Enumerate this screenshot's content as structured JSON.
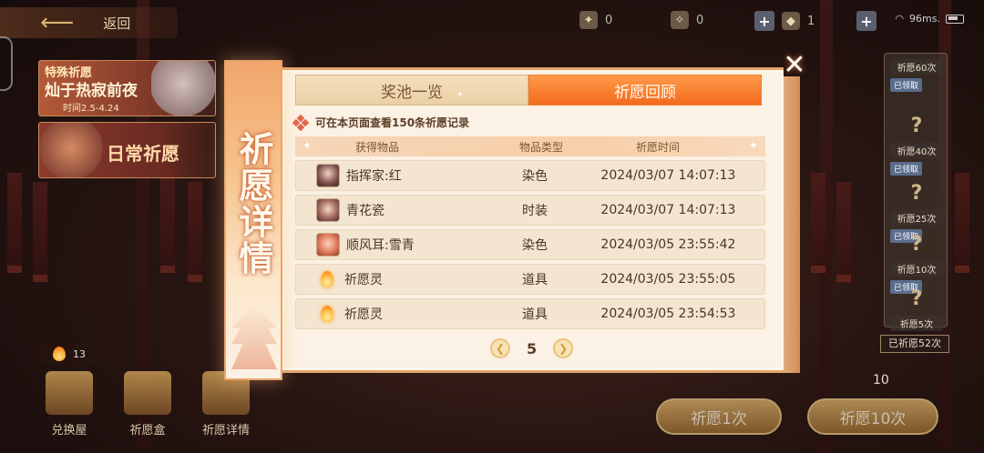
{
  "header": {
    "back_label": "返回",
    "resources": [
      {
        "icon": "wish-wand-icon",
        "value": "0"
      },
      {
        "icon": "gold-wand-icon",
        "value": "0"
      },
      {
        "icon": "crystal-icon",
        "value": "1"
      }
    ],
    "latency": "96ms."
  },
  "events": {
    "special": {
      "tag": "特殊祈愿",
      "title": "灿于热寂前夜",
      "date": "时间2.5-4.24"
    },
    "daily": {
      "title": "日常祈愿"
    }
  },
  "bottom_left": {
    "currency_value": "13",
    "buttons": [
      {
        "label": "兑换屋"
      },
      {
        "label": "祈愿盒"
      },
      {
        "label": "祈愿详情"
      }
    ]
  },
  "right_panel": {
    "rewards": [
      {
        "label": "祈愿60次",
        "badge": "已领取"
      },
      {
        "label": "祈愿40次",
        "badge": "已领取"
      },
      {
        "label": "祈愿25次",
        "badge": "已领取"
      },
      {
        "label": "祈愿10次",
        "badge": "已领取"
      },
      {
        "label": "祈愿5次",
        "badge": ""
      }
    ],
    "wished_count": "已祈愿52次",
    "pity_number": "10",
    "wish_once": "祈愿1次",
    "wish_ten": "祈愿10次"
  },
  "modal": {
    "side_title": "祈愿详情",
    "tabs": [
      {
        "label": "奖池一览",
        "active": false
      },
      {
        "label": "祈愿回顾",
        "active": true
      }
    ],
    "notice": "可在本页面查看150条祈愿记录",
    "columns": {
      "item": "获得物品",
      "type": "物品类型",
      "time": "祈愿时间"
    },
    "rows": [
      {
        "item": "指挥家:红",
        "type": "染色",
        "time": "2024/03/07 14:07:13",
        "icon": "avatar-red-icon"
      },
      {
        "item": "青花瓷",
        "type": "时装",
        "time": "2024/03/07 14:07:13",
        "icon": "avatar-qinghua-icon"
      },
      {
        "item": "顺风耳:雪青",
        "type": "染色",
        "time": "2024/03/05 23:55:42",
        "icon": "avatar-shunfeng-icon"
      },
      {
        "item": "祈愿灵",
        "type": "道具",
        "time": "2024/03/05 23:55:05",
        "icon": "wish-spirit-flame-icon"
      },
      {
        "item": "祈愿灵",
        "type": "道具",
        "time": "2024/03/05 23:54:53",
        "icon": "wish-spirit-flame-icon"
      }
    ],
    "page": "5"
  },
  "colors": {
    "accent_orange": "#f26a1c",
    "panel_cream": "#fbf1e4",
    "text_brown": "#4a3524"
  }
}
